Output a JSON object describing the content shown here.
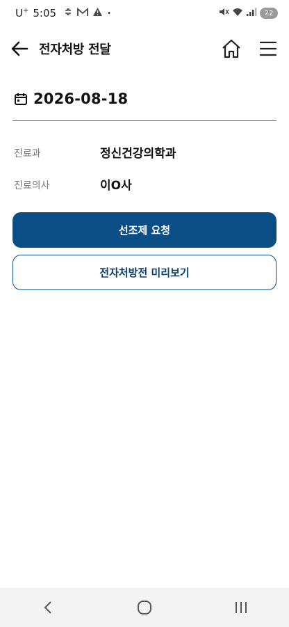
{
  "status_bar": {
    "carrier": "U",
    "carrier_sup": "+",
    "time": "5:05",
    "notification_icons": [
      "link-icon",
      "gmail-icon",
      "warning-icon"
    ],
    "dot": "•",
    "battery": "22"
  },
  "header": {
    "title": "전자처방 전달"
  },
  "date": {
    "value": "2026-08-18"
  },
  "info": [
    {
      "label": "진료과",
      "value": "정신건강의학과"
    },
    {
      "label": "진료의사",
      "value": "이O사"
    }
  ],
  "buttons": {
    "primary": "선조제 요청",
    "secondary": "전자처방전 미리보기"
  },
  "colors": {
    "primary": "#0b4d85",
    "nav_background": "#f3f3f3"
  }
}
